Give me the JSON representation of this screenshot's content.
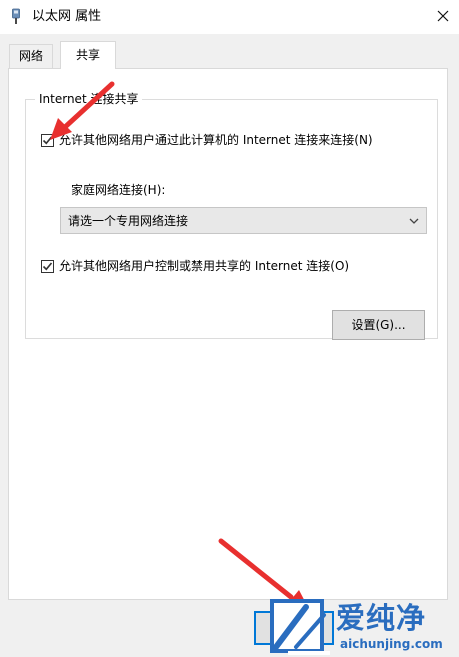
{
  "window": {
    "title": "以太网 属性",
    "close_glyph": "✕"
  },
  "tabs": [
    {
      "label": "网络",
      "active": false
    },
    {
      "label": "共享",
      "active": true
    }
  ],
  "sharing": {
    "group_title": "Internet 连接共享",
    "allow_connect_label": "允许其他网络用户通过此计算机的 Internet 连接来连接(N)",
    "allow_connect_checked": true,
    "home_network_label": "家庭网络连接(H):",
    "home_network_select": {
      "value": "请选一个专用网络连接"
    },
    "allow_control_label": "允许其他网络用户控制或禁用共享的 Internet 连接(O)",
    "allow_control_checked": true,
    "settings_button": "设置(G)..."
  },
  "annotations": {
    "arrow_color": "#e8302f",
    "arrow_count": 2
  },
  "watermark": {
    "logo_text": "爱纯净",
    "site": "aichunjing.com"
  },
  "colors": {
    "accent": "#0078d7",
    "client_bg": "#f0f0f0",
    "panel_bg": "#ffffff",
    "button_bg": "#e1e1e1",
    "select_bg": "#e8e8e8",
    "check_mark": "#333333"
  },
  "icons": {
    "title": "network-adapter-icon",
    "close": "close-icon",
    "checkbox": "checkmark-icon",
    "select": "chevron-down-icon"
  }
}
